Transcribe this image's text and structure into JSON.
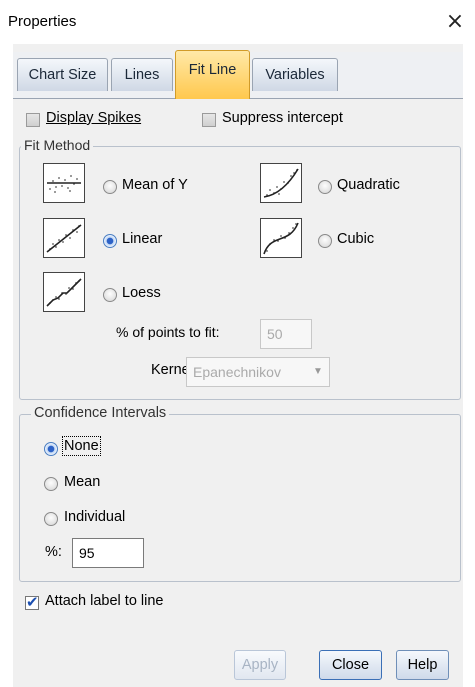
{
  "window": {
    "title": "Properties",
    "close_glyph": "×"
  },
  "tabs": [
    {
      "label": "Chart Size",
      "active": false
    },
    {
      "label": "Lines",
      "active": false
    },
    {
      "label": "Fit Line",
      "active": true
    },
    {
      "label": "Variables",
      "active": false
    }
  ],
  "options": {
    "display_spikes": {
      "label": "Display Spikes",
      "checked": false
    },
    "suppress_intercept": {
      "label": "Suppress intercept",
      "checked": false
    }
  },
  "fit_method": {
    "legend": "Fit Method",
    "methods": {
      "mean_of_y": {
        "label": "Mean of Y",
        "selected": false,
        "icon": "mean-fit-icon"
      },
      "quadratic": {
        "label": "Quadratic",
        "selected": false,
        "icon": "quadratic-fit-icon"
      },
      "linear": {
        "label": "Linear",
        "selected": true,
        "icon": "linear-fit-icon"
      },
      "cubic": {
        "label": "Cubic",
        "selected": false,
        "icon": "cubic-fit-icon"
      },
      "loess": {
        "label": "Loess",
        "selected": false,
        "icon": "loess-fit-icon"
      }
    },
    "points_to_fit": {
      "label": "% of points to fit:",
      "value": "50",
      "enabled": false
    },
    "kernel": {
      "label": "Kernel:",
      "value": "Epanechnikov",
      "enabled": false
    }
  },
  "confidence": {
    "legend": "Confidence Intervals",
    "none": {
      "label": "None",
      "selected": true
    },
    "mean": {
      "label": "Mean",
      "selected": false
    },
    "individual": {
      "label": "Individual",
      "selected": false
    },
    "percent": {
      "label": "%:",
      "value": "95"
    }
  },
  "attach_label": {
    "label": "Attach label to line",
    "checked": true
  },
  "buttons": {
    "apply": "Apply",
    "close": "Close",
    "help": "Help"
  }
}
